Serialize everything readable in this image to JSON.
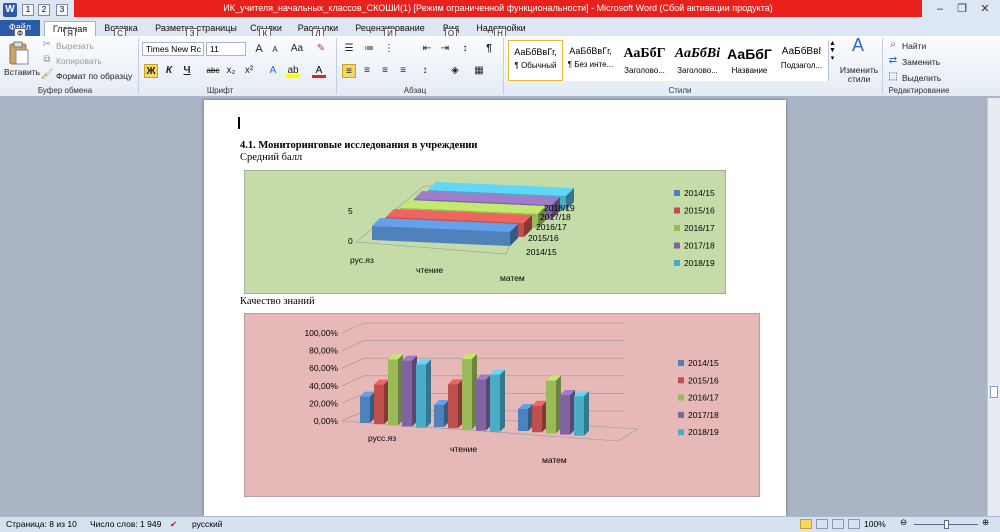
{
  "window": {
    "title": "ИК_учителя_начальных_классов_СКОШИ(1) [Режим ограниченной функциональности] - Microsoft Word (Сбой активации продукта)",
    "app_icon": "W",
    "qat_keys": [
      "1",
      "2",
      "3"
    ],
    "minimize": "–",
    "maximize": "❐",
    "close": "✕"
  },
  "tabs": [
    {
      "label": "Файл",
      "key": "Ф"
    },
    {
      "label": "Главная",
      "key": "Я"
    },
    {
      "label": "Вставка",
      "key": "С"
    },
    {
      "label": "Разметка страницы",
      "key": "З"
    },
    {
      "label": "Ссылки",
      "key": "К"
    },
    {
      "label": "Рассылки",
      "key": "Л"
    },
    {
      "label": "Рецензирование",
      "key": "И"
    },
    {
      "label": "Вид",
      "key": "О"
    },
    {
      "label": "Надстройки",
      "key": "Н"
    }
  ],
  "ribbon": {
    "clipboard": {
      "paste": "Вставить",
      "cut": "Вырезать",
      "copy": "Копировать",
      "format_painter": "Формат по образцу",
      "group": "Буфер обмена"
    },
    "font": {
      "name": "Times New Rc",
      "size": "11",
      "grow": "A",
      "shrink": "A",
      "case": "Aa",
      "bold": "Ж",
      "italic": "К",
      "underline": "Ч",
      "strike": "abc",
      "subscript": "x₂",
      "superscript": "x²",
      "group": "Шрифт"
    },
    "paragraph": {
      "group": "Абзац",
      "pilcrow": "¶"
    },
    "styles": {
      "items": [
        {
          "sample": "АаБбВвГг,",
          "name": "¶ Обычный"
        },
        {
          "sample": "АаБбВвГг,",
          "name": "¶ Без инте..."
        },
        {
          "sample": "АаБбГ",
          "name": "Заголово..."
        },
        {
          "sample": "АаБбВі",
          "name": "Заголово..."
        },
        {
          "sample": "АаБбГ",
          "name": "Название"
        },
        {
          "sample": "АаБбВвІ",
          "name": "Подзагол..."
        }
      ],
      "change": "Изменить стили",
      "group": "Стили"
    },
    "editing": {
      "find": "Найти",
      "replace": "Заменить",
      "select": "Выделить",
      "group": "Редактирование"
    }
  },
  "document": {
    "cursor": "|",
    "heading": "4.1. Мониторинговые исследования в учреждении",
    "caption1": "Средний балл",
    "caption2": "Качество знаний"
  },
  "chart_data": [
    {
      "type": "bar",
      "subtype": "3d-column",
      "categories": [
        "рус.яз",
        "чтение",
        "матем"
      ],
      "series": [
        {
          "name": "2014/15",
          "color": "#4f81bd"
        },
        {
          "name": "2015/16",
          "color": "#c0504d"
        },
        {
          "name": "2016/17",
          "color": "#9bbb59"
        },
        {
          "name": "2017/18",
          "color": "#8064a2"
        },
        {
          "name": "2018/19",
          "color": "#4bacc6"
        }
      ],
      "depth_labels": [
        "2014/15",
        "2015/16",
        "2016/17",
        "2017/18",
        "2018/19"
      ],
      "y_ticks": [
        "0",
        "5"
      ],
      "background": "#c6dca8",
      "legend": "right"
    },
    {
      "type": "bar",
      "subtype": "3d-clustered-column",
      "categories": [
        "русс.яз",
        "чтение",
        "матем"
      ],
      "y_ticks": [
        "0,00%",
        "20,00%",
        "40,00%",
        "60,00%",
        "80,00%",
        "100,00%"
      ],
      "ylim": [
        0,
        100
      ],
      "series": [
        {
          "name": "2014/15",
          "color": "#4f81bd",
          "values": [
            30,
            25,
            25
          ]
        },
        {
          "name": "2015/16",
          "color": "#c0504d",
          "values": [
            45,
            50,
            30
          ]
        },
        {
          "name": "2016/17",
          "color": "#9bbb59",
          "values": [
            75,
            80,
            60
          ]
        },
        {
          "name": "2017/18",
          "color": "#8064a2",
          "values": [
            75,
            58,
            45
          ]
        },
        {
          "name": "2018/19",
          "color": "#4bacc6",
          "values": [
            72,
            65,
            45
          ]
        }
      ],
      "background": "#e6b8b8",
      "legend": "right"
    }
  ],
  "status": {
    "page": "Страница: 8 из 10",
    "words": "Число слов: 1 949",
    "language": "русский",
    "zoom": "100%"
  }
}
